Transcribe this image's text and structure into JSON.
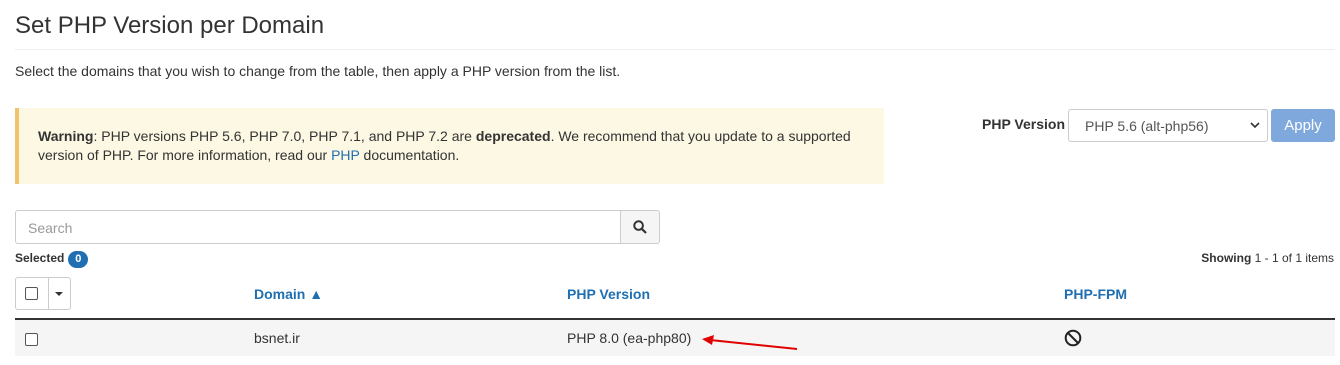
{
  "page": {
    "title": "Set PHP Version per Domain",
    "description": "Select the domains that you wish to change from the table, then apply a PHP version from the list."
  },
  "warning": {
    "label": "Warning",
    "text_1": ": PHP versions PHP 5.6, PHP 7.0, PHP 7.1, and PHP 7.2 are ",
    "deprecated": "deprecated",
    "text_2": ". We recommend that you update to a supported version of PHP. For more information, read our ",
    "link": "PHP",
    "text_3": " documentation."
  },
  "controls": {
    "php_version_label": "PHP Version",
    "php_version_selected": "PHP 5.6 (alt-php56)",
    "apply_label": "Apply"
  },
  "search": {
    "placeholder": "Search"
  },
  "selection": {
    "label": "Selected",
    "count": "0"
  },
  "pagination": {
    "showing_label": "Showing",
    "range": " 1 - 1 of 1 items"
  },
  "table": {
    "columns": {
      "domain": "Domain ▲",
      "php_version": "PHP Version",
      "php_fpm": "PHP-FPM"
    },
    "rows": [
      {
        "domain": "bsnet.ir",
        "php_version": "PHP 8.0 (ea-php80)",
        "php_fpm_icon": "disabled-icon"
      }
    ]
  },
  "colors": {
    "link": "#1f6fb2",
    "warning_bg": "#fcf8e3",
    "warning_border": "#f0c36d",
    "apply_bg": "#7fa9dc",
    "annotation_arrow": "#e00000"
  }
}
